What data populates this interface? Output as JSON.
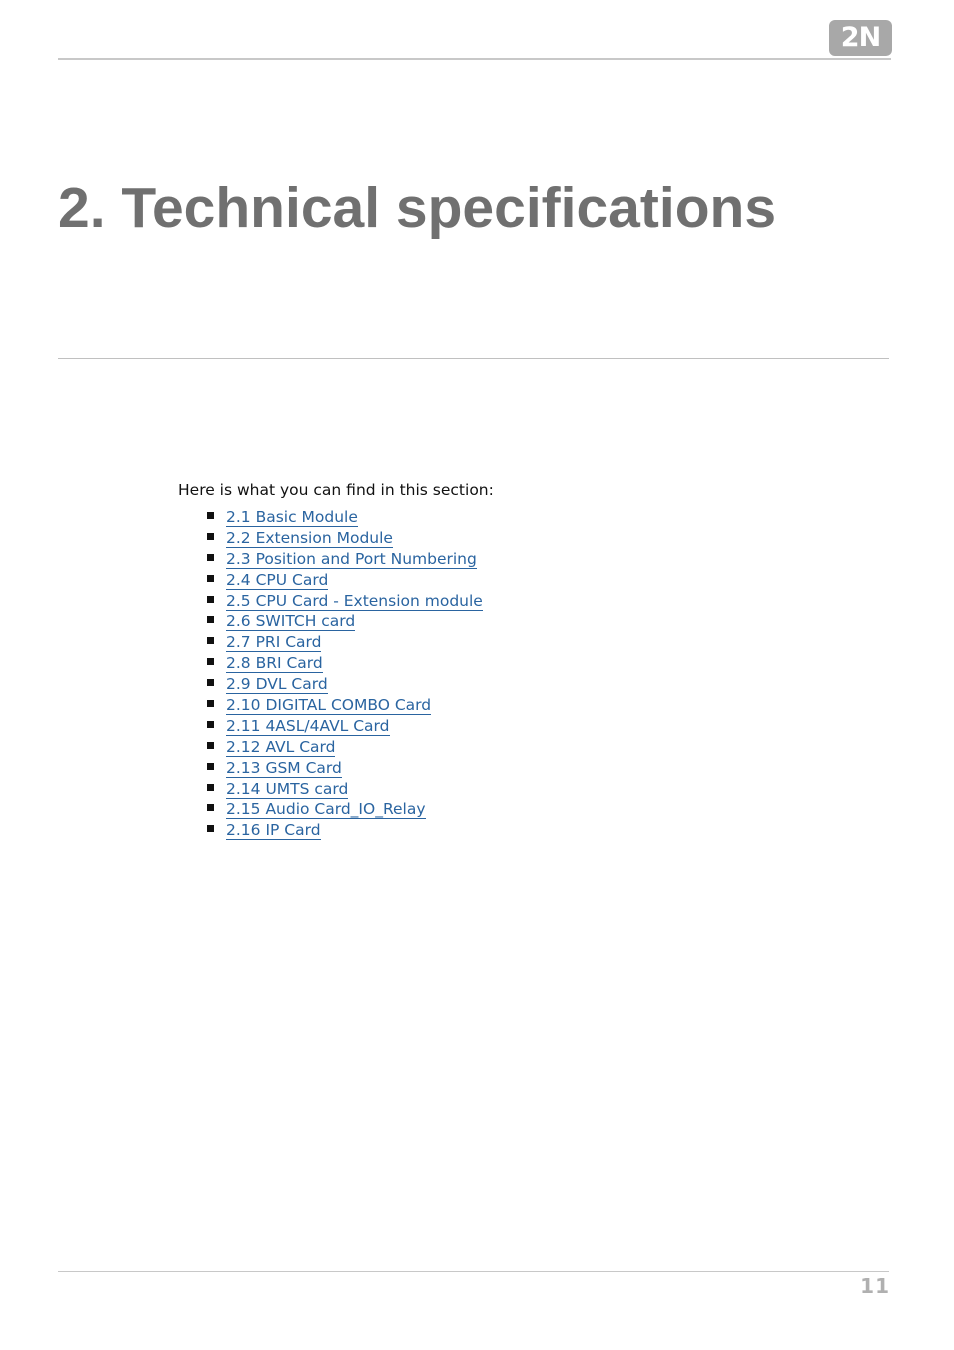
{
  "header": {
    "logo_text": "2N"
  },
  "title": "2. Technical specifications",
  "intro": "Here is what you can find in this section:",
  "toc": [
    {
      "label": "2.1 Basic Module"
    },
    {
      "label": "2.2 Extension Module"
    },
    {
      "label": "2.3 Position and Port Numbering"
    },
    {
      "label": "2.4 CPU Card"
    },
    {
      "label": "2.5 CPU Card - Extension module"
    },
    {
      "label": "2.6 SWITCH card"
    },
    {
      "label": "2.7 PRI Card"
    },
    {
      "label": "2.8 BRI Card"
    },
    {
      "label": "2.9 DVL Card"
    },
    {
      "label": "2.10 DIGITAL COMBO Card"
    },
    {
      "label": "2.11 4ASL/4AVL Card"
    },
    {
      "label": "2.12 AVL Card"
    },
    {
      "label": "2.13 GSM Card"
    },
    {
      "label": "2.14 UMTS card"
    },
    {
      "label": "2.15 Audio Card_IO_Relay"
    },
    {
      "label": "2.16 IP Card"
    }
  ],
  "footer": {
    "page_number": "11"
  },
  "colors": {
    "link": "#2a64a0",
    "title": "#707070",
    "logo_bg": "#a8a8a8"
  }
}
